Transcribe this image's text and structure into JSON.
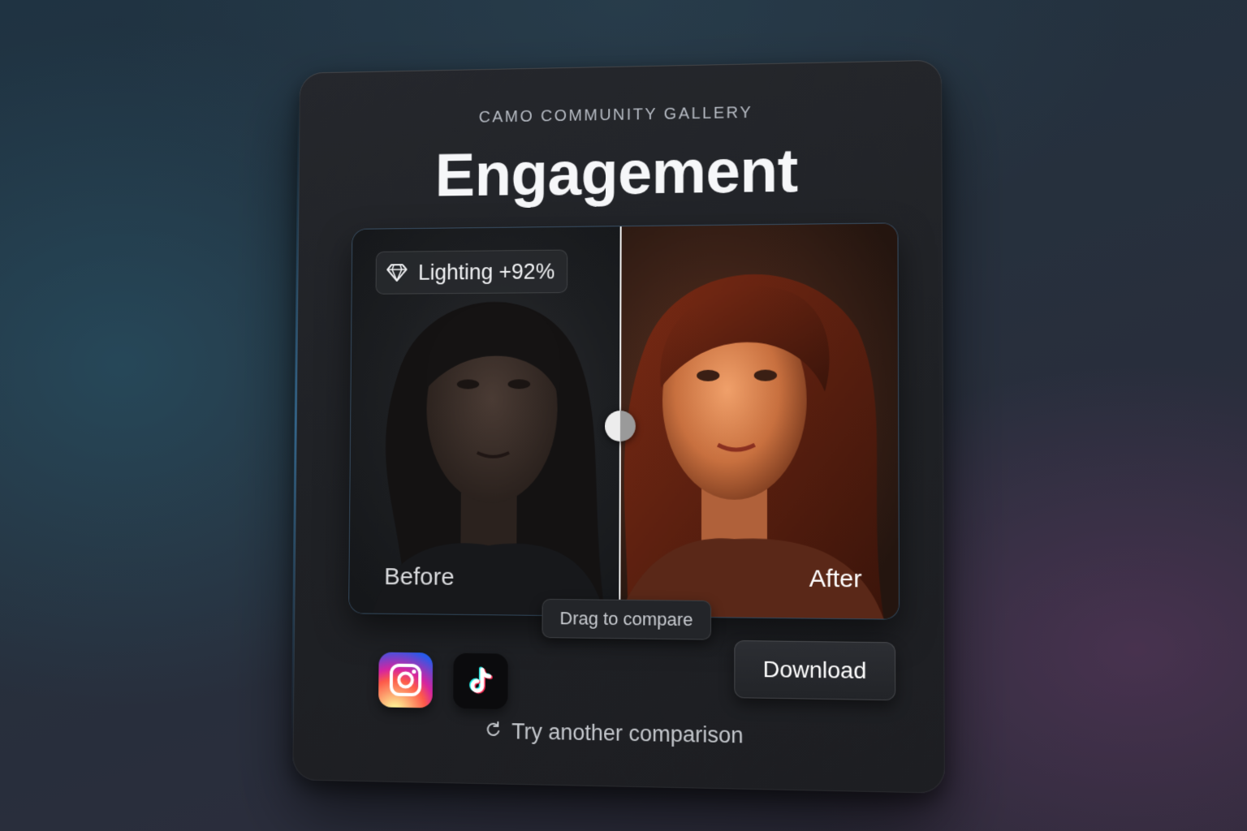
{
  "header": {
    "eyebrow": "CAMO COMMUNITY GALLERY",
    "title": "Engagement"
  },
  "compare": {
    "badge_icon": "diamond-icon",
    "badge_label": "Lighting +92%",
    "before_label": "Before",
    "after_label": "After",
    "drag_hint": "Drag to compare",
    "split_position": 0.5
  },
  "share": {
    "icons": [
      "instagram-icon",
      "tiktok-icon"
    ]
  },
  "actions": {
    "download_label": "Download",
    "retry_icon": "refresh-icon",
    "retry_label": "Try another comparison"
  },
  "colors": {
    "card": "#202226",
    "accent_edge": "#4696d2",
    "after_warm": "#c85a2a"
  }
}
